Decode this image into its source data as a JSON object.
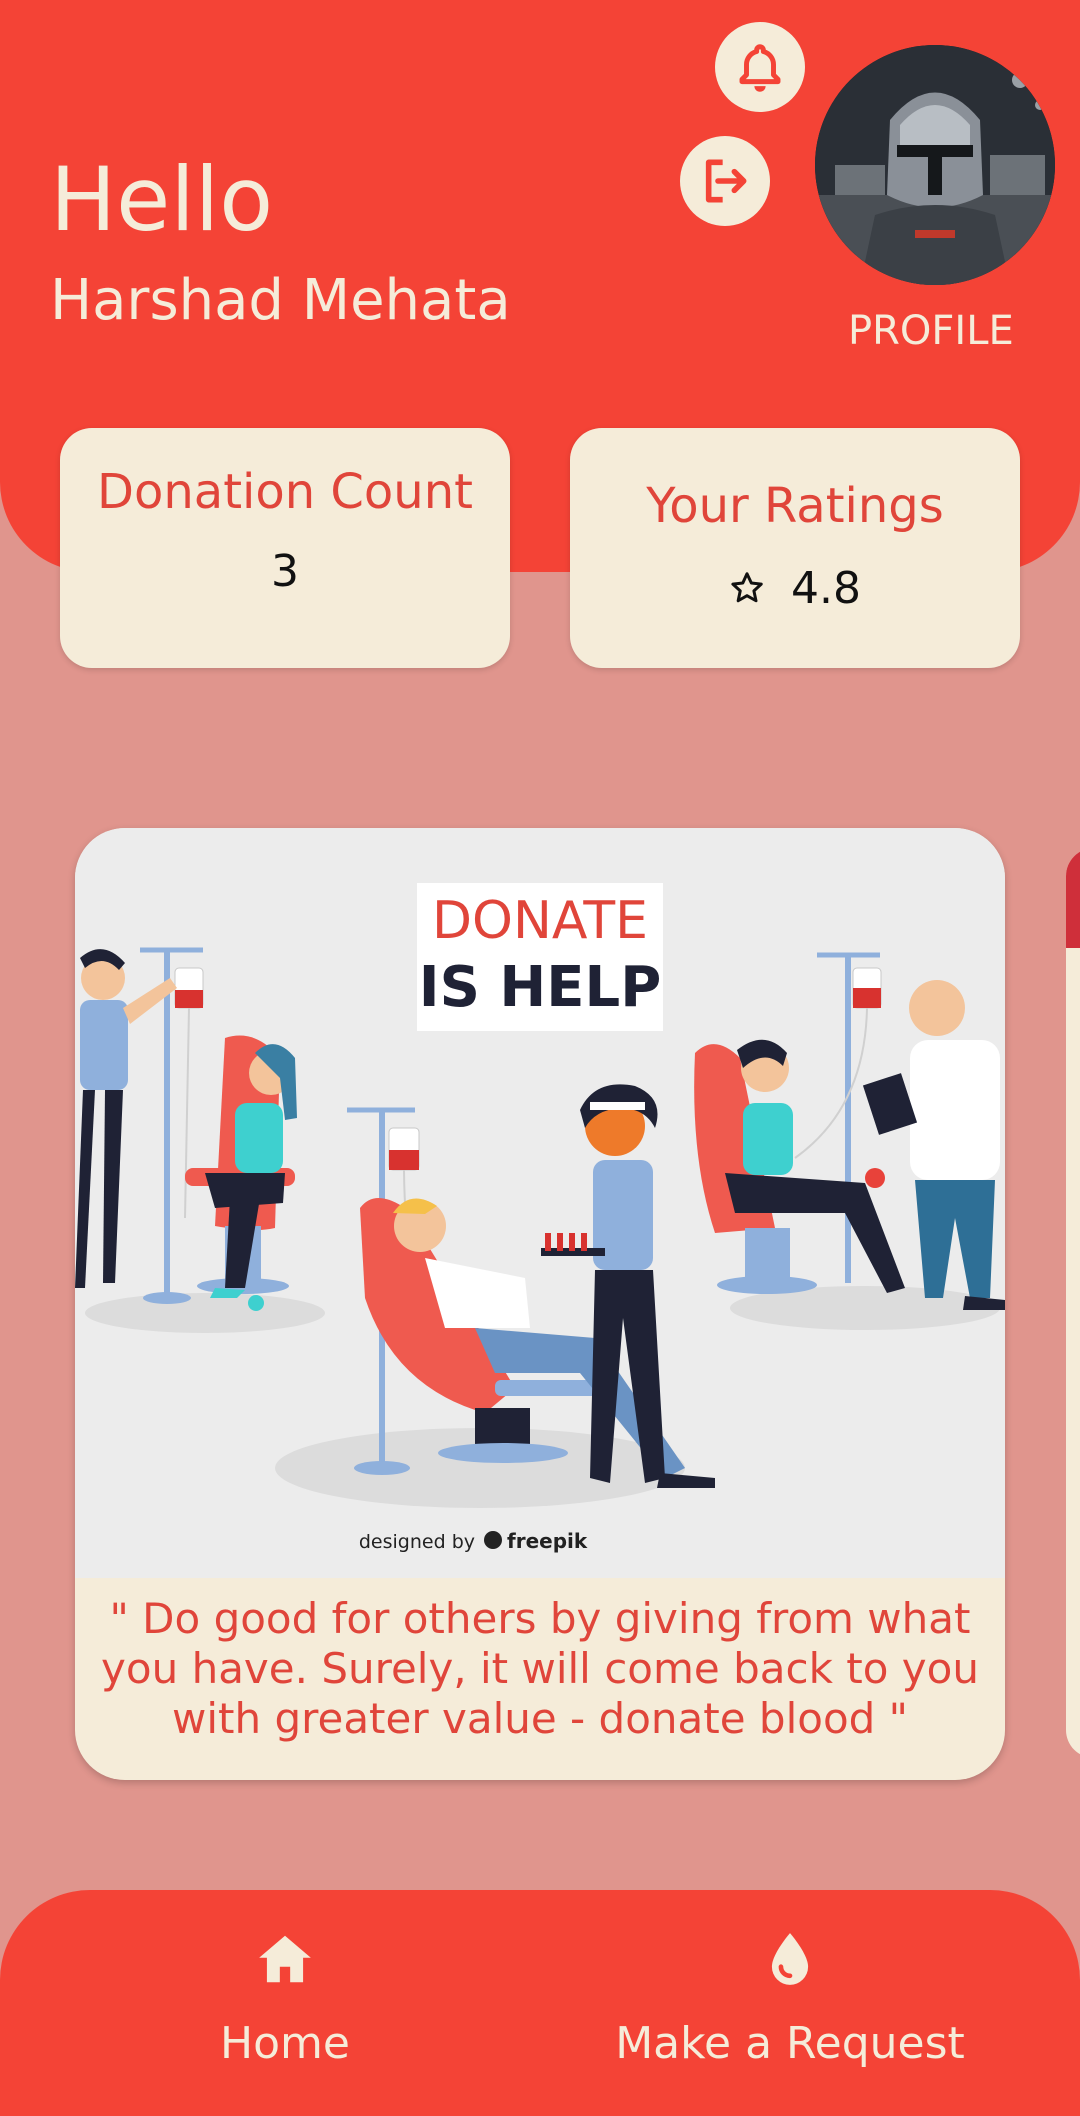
{
  "header": {
    "greeting": "Hello",
    "user_name": "Harshad Mehata",
    "profile_label": "PROFILE",
    "icons": [
      "bell-icon",
      "logout-icon"
    ]
  },
  "stats": {
    "donation_count_title": "Donation Count",
    "donation_count_value": "3",
    "ratings_title": "Your Ratings",
    "ratings_value": "4.8",
    "ratings_icon": "star-outline-icon"
  },
  "carousel": {
    "banner_line1": "DONATE",
    "banner_line2": "IS HELP",
    "credit_prefix": "designed by",
    "credit_brand": "freepik",
    "quote": "\" Do good for others by giving from what you have. Surely, it will come back to you with greater value - donate blood \""
  },
  "bottom_nav": {
    "items": [
      {
        "label": "Home",
        "icon": "home-icon"
      },
      {
        "label": "Make a Request",
        "icon": "blood-drop-icon"
      }
    ]
  },
  "colors": {
    "accent": "#f44336",
    "background": "#e0958d",
    "card": "#f5ecd9",
    "accent_text": "#e0453a"
  }
}
